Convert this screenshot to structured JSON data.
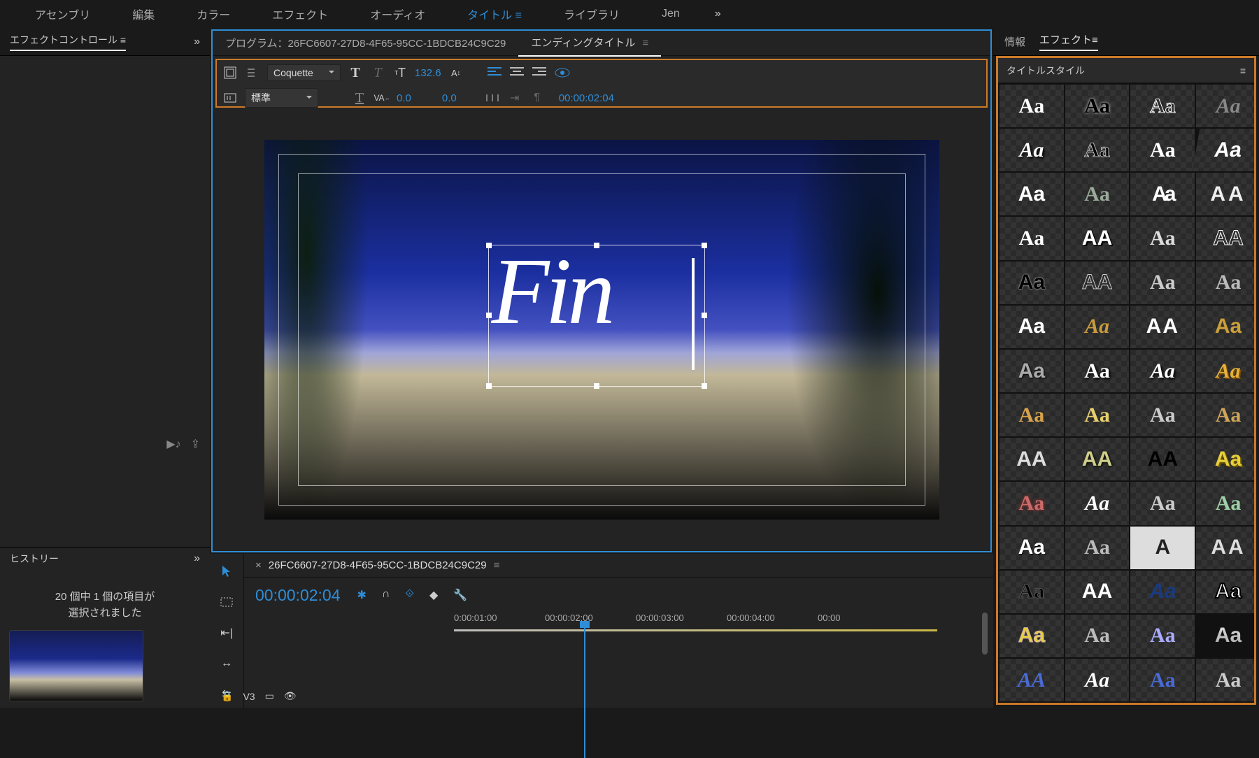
{
  "workspaces": {
    "items": [
      "アセンブリ",
      "編集",
      "カラー",
      "エフェクト",
      "オーディオ",
      "タイトル",
      "ライブラリ",
      "Jen"
    ],
    "active_index": 5
  },
  "left_panel": {
    "title": "エフェクトコントロール",
    "bottom_title": "ヒストリー",
    "status_line1": "20 個中 1 個の項目が",
    "status_line2": "選択されました"
  },
  "program_panel": {
    "tabs": [
      {
        "label": "プログラム：26FC6607-27D8-4F65-95CC-1BDCB24C9C29",
        "active": false
      },
      {
        "label": "エンディングタイトル",
        "active": true
      }
    ],
    "font_family": "Coquette",
    "font_weight": "標準",
    "font_size": "132.6",
    "tracking": "0.0",
    "leading": "0.0",
    "timecode": "00:00:02:04",
    "title_text": "Fin"
  },
  "timeline": {
    "name": "26FC6607-27D8-4F65-95CC-1BDCB24C9C29",
    "current_time": "00:00:02:04",
    "ruler": [
      "0:00:01:00",
      "00:00:02:00",
      "00:00:03:00",
      "00:00:04:00",
      "00:00"
    ],
    "track_label": "V3"
  },
  "right_panel": {
    "tabs": {
      "info": "情報",
      "effects": "エフェクト",
      "active_index": 1
    },
    "styles_title": "タイトルスタイル",
    "swatches": [
      {
        "t": "Aa",
        "c": "#fff",
        "f": "serif",
        "s": ""
      },
      {
        "t": "Aa",
        "c": "#000",
        "f": "serif",
        "s": "text-shadow:0 0 4px #fff"
      },
      {
        "t": "Aa",
        "c": "#fff",
        "f": "serif",
        "s": "-webkit-text-stroke:1px #fff;color:transparent"
      },
      {
        "t": "Aa",
        "c": "#888",
        "f": "cursive",
        "s": "font-style:italic"
      },
      {
        "t": "Aa",
        "c": "#fff",
        "f": "cursive",
        "s": "font-style:italic;text-shadow:2px 2px 3px #000"
      },
      {
        "t": "Aa",
        "c": "#000",
        "f": "serif",
        "s": "-webkit-text-stroke:1px #bbb"
      },
      {
        "t": "Aa",
        "c": "#fff",
        "f": "serif",
        "s": ""
      },
      {
        "t": "Aa",
        "c": "#fff",
        "f": "sans-serif",
        "s": "font-weight:900;transform:skewX(-10deg)"
      },
      {
        "t": "Aa",
        "c": "#fff",
        "f": "sans-serif",
        "s": "font-weight:800"
      },
      {
        "t": "Aa",
        "c": "#9a9",
        "f": "cursive",
        "s": ""
      },
      {
        "t": "Aa",
        "c": "#fff",
        "f": "sans-serif",
        "s": "font-weight:900;letter-spacing:-4px"
      },
      {
        "t": "AA",
        "c": "#eee",
        "f": "sans-serif",
        "s": "letter-spacing:4px"
      },
      {
        "t": "Aa",
        "c": "#fff",
        "f": "serif",
        "s": "font-weight:800"
      },
      {
        "t": "AA",
        "c": "#fff",
        "f": "sans-serif",
        "s": "text-shadow:2px 2px 0 #000"
      },
      {
        "t": "Aa",
        "c": "#ddd",
        "f": "serif",
        "s": ""
      },
      {
        "t": "AA",
        "c": "#fff",
        "f": "sans-serif",
        "s": "-webkit-text-stroke:1px #fff;color:transparent"
      },
      {
        "t": "Aa",
        "c": "#000",
        "f": "sans-serif",
        "s": "font-weight:900;text-shadow:0 0 2px #fff"
      },
      {
        "t": "AA",
        "c": "#999",
        "f": "sans-serif",
        "s": "-webkit-text-stroke:1px #ccc;color:transparent"
      },
      {
        "t": "Aa",
        "c": "#ccc",
        "f": "serif",
        "s": ""
      },
      {
        "t": "Aa",
        "c": "#bbb",
        "f": "serif",
        "s": ""
      },
      {
        "t": "Aa",
        "c": "#fff",
        "f": "sans-serif",
        "s": "text-shadow:2px 3px 0 #333"
      },
      {
        "t": "Aa",
        "c": "#c89b3c",
        "f": "cursive",
        "s": "font-style:italic"
      },
      {
        "t": "AA",
        "c": "#fff",
        "f": "sans-serif",
        "s": "letter-spacing:2px"
      },
      {
        "t": "Aa",
        "c": "#caa03a",
        "f": "sans-serif",
        "s": ""
      },
      {
        "t": "Aa",
        "c": "#aaa",
        "f": "sans-serif",
        "s": "text-shadow:1px 1px 2px #000"
      },
      {
        "t": "Aa",
        "c": "#fff",
        "f": "serif",
        "s": "text-shadow:2px 2px 3px #000"
      },
      {
        "t": "Aa",
        "c": "#fff",
        "f": "serif",
        "s": "font-style:italic;text-shadow:2px 2px 3px #000"
      },
      {
        "t": "Aa",
        "c": "#e6b23a",
        "f": "cursive",
        "s": "font-style:italic;font-weight:800;text-shadow:2px 2px 0 #7a4a00"
      },
      {
        "t": "Aa",
        "c": "#d7a24a",
        "f": "serif",
        "s": ""
      },
      {
        "t": "Aa",
        "c": "#e7cf6b",
        "f": "serif",
        "s": ""
      },
      {
        "t": "Aa",
        "c": "#ccc",
        "f": "serif",
        "s": ""
      },
      {
        "t": "Aa",
        "c": "#cda45a",
        "f": "serif",
        "s": ""
      },
      {
        "t": "AA",
        "c": "#ddd",
        "f": "sans-serif",
        "s": ""
      },
      {
        "t": "AA",
        "c": "#cfcf8a",
        "f": "sans-serif",
        "s": "text-shadow:1px 1px 3px #000"
      },
      {
        "t": "AA",
        "c": "#000",
        "f": "sans-serif",
        "s": "font-weight:900"
      },
      {
        "t": "Aa",
        "c": "#e7cf3b",
        "f": "sans-serif",
        "s": "font-weight:900;text-shadow:2px 2px 0 #6b5a00"
      },
      {
        "t": "Aa",
        "c": "#c96b6b",
        "f": "serif",
        "s": "text-shadow:0 0 5px #a33"
      },
      {
        "t": "Aa",
        "c": "#fff",
        "f": "serif",
        "s": "font-style:italic;font-weight:700"
      },
      {
        "t": "Aa",
        "c": "#ccc",
        "f": "serif",
        "s": ""
      },
      {
        "t": "Aa",
        "c": "#9ed0a8",
        "f": "serif",
        "s": ""
      },
      {
        "t": "Aa",
        "c": "#fff",
        "f": "sans-serif",
        "s": "font-weight:800;text-shadow:1px 1px 0 #000"
      },
      {
        "t": "Aa",
        "c": "#bbb",
        "f": "serif",
        "s": ""
      },
      {
        "t": "A",
        "c": "#222",
        "f": "sans-serif",
        "s": "background:#ddd;padding:0 12px;font-weight:900"
      },
      {
        "t": "AA",
        "c": "#ddd",
        "f": "sans-serif",
        "s": "letter-spacing:3px"
      },
      {
        "t": "Aa",
        "c": "#000",
        "f": "serif",
        "s": "-webkit-text-stroke:1px #555"
      },
      {
        "t": "AA",
        "c": "#fff",
        "f": "sans-serif",
        "s": "font-weight:800"
      },
      {
        "t": "Aa",
        "c": "#1a3a80",
        "f": "sans-serif",
        "s": "font-weight:900;font-style:italic"
      },
      {
        "t": "Aa",
        "c": "#fff",
        "f": "sans-serif",
        "s": "font-weight:900;-webkit-text-stroke:2px #000"
      },
      {
        "t": "Aa",
        "c": "#e7cf3b",
        "f": "sans-serif",
        "s": "-webkit-text-stroke:1px #caa"
      },
      {
        "t": "Aa",
        "c": "#bbb",
        "f": "serif",
        "s": ""
      },
      {
        "t": "Aa",
        "c": "#aaf",
        "f": "serif",
        "s": ""
      },
      {
        "t": "Aa",
        "c": "#cfcfcf",
        "f": "sans-serif",
        "s": "font-weight:800;background:linear-gradient(#fff,#888);-webkit-background-clip:text;color:transparent"
      },
      {
        "t": "AA",
        "c": "#4a6bd6",
        "f": "serif",
        "s": "font-style:italic"
      },
      {
        "t": "Aa",
        "c": "#fff",
        "f": "serif",
        "s": "font-style:italic"
      },
      {
        "t": "Aa",
        "c": "#4a6bd6",
        "f": "serif",
        "s": ""
      },
      {
        "t": "Aa",
        "c": "#ccc",
        "f": "serif",
        "s": ""
      }
    ]
  }
}
